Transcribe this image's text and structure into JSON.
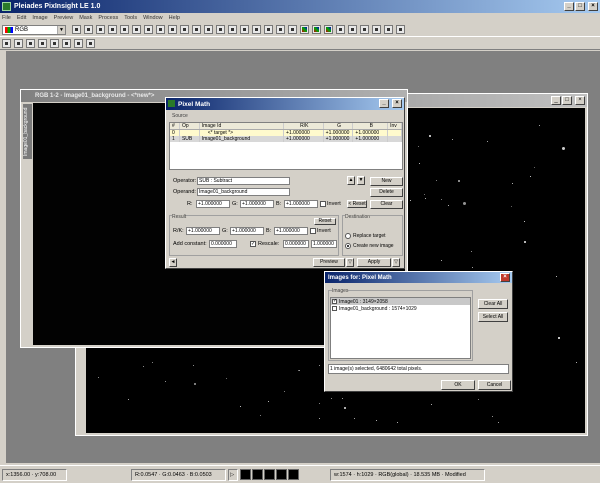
{
  "app": {
    "title": "Pleiades PixInsight LE 1.0"
  },
  "menu": [
    "File",
    "Edit",
    "Image",
    "Preview",
    "Mask",
    "Process",
    "Tools",
    "Window",
    "Help"
  ],
  "toolbar": {
    "color_space": "RGB"
  },
  "image_window_1": {
    "title": "RGB 1-2 - Image01_background - <*new*>",
    "side_tab": "Image01_background"
  },
  "pixel_math": {
    "title": "Pixel Math",
    "source_label": "Source",
    "columns": [
      "#",
      "Op",
      "Image Id",
      "R/K",
      "G",
      "B",
      "Inv"
    ],
    "rows": [
      {
        "num": "0",
        "op": "",
        "id": "<* target *>",
        "rk": "+1.000000",
        "g": "+1.000000",
        "b": "+1.000000",
        "inv": ""
      },
      {
        "num": "1",
        "op": "SUB",
        "id": "Image01_background",
        "rk": "+1.000000",
        "g": "+1.000000",
        "b": "+1.000000",
        "inv": ""
      }
    ],
    "operator_label": "Operator:",
    "operator_value": "SUB : Subtract",
    "operand_label": "Operand:",
    "operand_value": "Image01_background",
    "new_label": "New",
    "delete_label": "Delete",
    "clear_label": "Clear",
    "coef": {
      "r_label": "R:",
      "r": "+1.000000",
      "g_label": "G:",
      "g": "+1.000000",
      "b_label": "B:",
      "b": "+1.000000"
    },
    "invert_label": "Invert",
    "reset_label": "< Reset",
    "result_label": "Result",
    "result_reset_label": "Reset",
    "result": {
      "rk_label": "R/K:",
      "rk": "+1.000000",
      "g_label": "G:",
      "g": "+1.000000",
      "b_label": "B:",
      "b": "+1.000000"
    },
    "add_constant_label": "Add constant:",
    "add_constant": "0.000000",
    "rescale_label": "Rescale:",
    "rescale_min": "0.000000",
    "rescale_max": "1.000000",
    "destination_label": "Destination",
    "replace_target_label": "Replace target",
    "create_new_label": "Create new image",
    "preview_label": "Preview",
    "apply_label": "Apply"
  },
  "images_dialog": {
    "title": "Images for: Pixel Math",
    "group_label": "Images",
    "items": [
      {
        "label": "Image01 : 3149×2058",
        "checked": true
      },
      {
        "label": "Image01_background : 1574×1029",
        "checked": false
      }
    ],
    "clear_all": "Clear All",
    "select_all": "Select All",
    "status": "1 image(s) selected, 6480642 total pixels.",
    "ok": "OK",
    "cancel": "Cancel"
  },
  "statusbar": {
    "coords": "x:1356.00 · y:708.00",
    "values": "R:0.0547 · G:0.0463 · B:0.0503",
    "info": "w:1574 · h:1029 · RGB(global) · 18.535 MB · Modified"
  }
}
